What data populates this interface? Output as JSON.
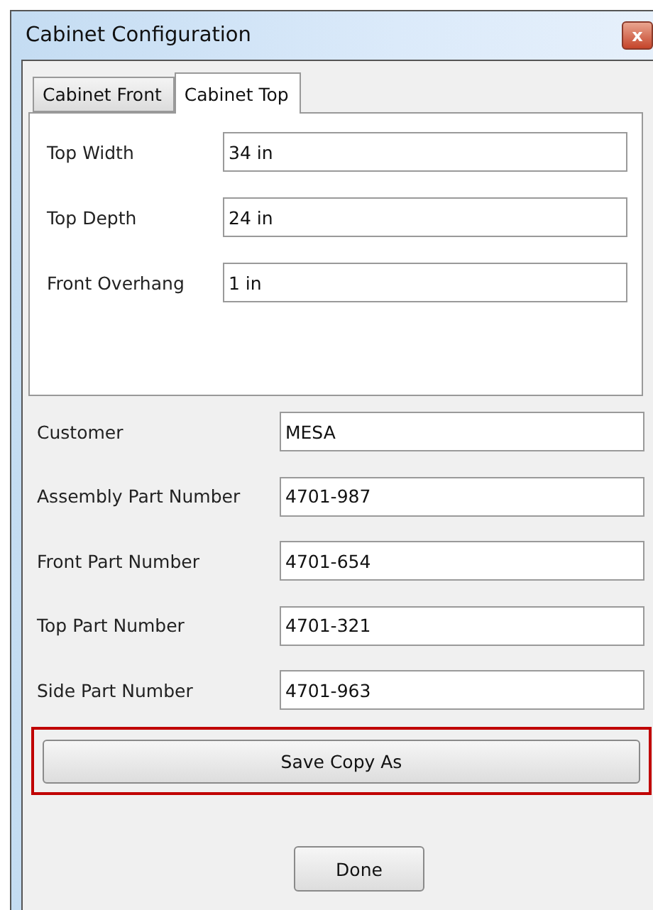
{
  "window": {
    "title": "Cabinet Configuration",
    "close_glyph": "x"
  },
  "tabs": [
    {
      "label": "Cabinet Front",
      "selected": false
    },
    {
      "label": "Cabinet Top",
      "selected": true
    }
  ],
  "tab_fields": [
    {
      "label": "Top Width",
      "value": "34 in"
    },
    {
      "label": "Top Depth",
      "value": "24 in"
    },
    {
      "label": "Front Overhang",
      "value": "1 in"
    }
  ],
  "fields": [
    {
      "label": "Customer",
      "value": "MESA"
    },
    {
      "label": "Assembly Part Number",
      "value": "4701-987"
    },
    {
      "label": "Front Part Number",
      "value": "4701-654"
    },
    {
      "label": "Top Part Number",
      "value": "4701-321"
    },
    {
      "label": "Side Part Number",
      "value": "4701-963"
    }
  ],
  "save_button": {
    "label": "Save Copy As",
    "highlighted": true
  },
  "done_button": {
    "label": "Done"
  }
}
